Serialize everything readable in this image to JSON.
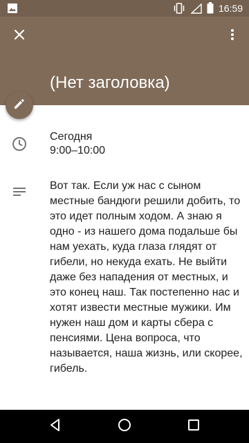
{
  "status_bar": {
    "time": "16:59",
    "icons": [
      "image-icon",
      "vibrate-icon",
      "signal-icon",
      "battery-icon"
    ]
  },
  "header": {
    "close_icon": "close-icon",
    "more_icon": "more-vert-icon",
    "title": "(Нет заголовка)",
    "color": "#806b58"
  },
  "edit_button": {
    "icon": "pencil-icon"
  },
  "event_time": {
    "icon": "clock-icon",
    "day": "Сегодня",
    "range": "9:00–10:00"
  },
  "event_description": {
    "icon": "notes-icon",
    "text": "Вот так. Если уж нас с сыном местные бандюги решили добить, то это идет полным ходом. А знаю я одно - из нашего дома подальше бы нам уехать, куда глаза глядят от гибели, но некуда ехать. Не выйти даже без нападения от местных, и это конец наш. Так постепенно нас и хотят извести местные мужики. Им нужен наш дом и карты сбера с пенсиями. Цена вопроса, что называется, наша жизнь, или скорее, гибель."
  },
  "nav_bar": {
    "buttons": [
      "back-icon",
      "home-icon",
      "recents-icon"
    ]
  }
}
